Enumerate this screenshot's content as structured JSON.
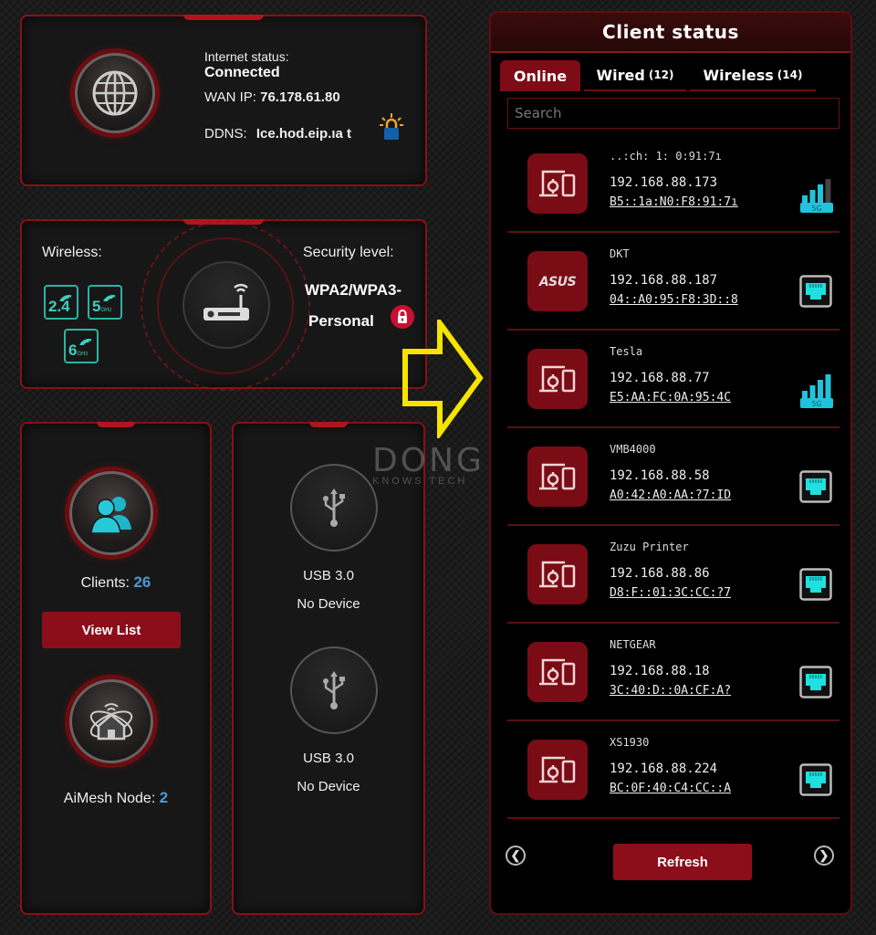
{
  "internet": {
    "status_label": "Internet status:",
    "status_value": "Connected",
    "wan_ip_label": "WAN IP:",
    "wan_ip_value": "76.178.61.80",
    "ddns_label": "DDNS:",
    "ddns_value": "Ice.hod.eip.ıa t"
  },
  "wireless": {
    "label": "Wireless:",
    "bands": [
      {
        "num": "2.4",
        "unit": ""
      },
      {
        "num": "5",
        "unit": "GHz"
      },
      {
        "num": "6",
        "unit": "GHz"
      }
    ],
    "security_label": "Security level:",
    "security_value_line1": "WPA2/WPA3-",
    "security_value_line2": "Personal"
  },
  "clients": {
    "label": "Clients:",
    "count": "26",
    "view_list_label": "View List",
    "aimesh_label": "AiMesh Node:",
    "aimesh_count": "2"
  },
  "usb": [
    {
      "type": "USB 3.0",
      "status": "No Device"
    },
    {
      "type": "USB 3.0",
      "status": "No Device"
    }
  ],
  "watermark": {
    "line1": "DONG",
    "line2": "KNOWS TECH"
  },
  "client_status": {
    "title": "Client status",
    "tabs": [
      {
        "label": "Online",
        "count": "",
        "active": true
      },
      {
        "label": "Wired",
        "count": "(12)",
        "active": false
      },
      {
        "label": "Wireless",
        "count": "(14)",
        "active": false
      }
    ],
    "search_placeholder": "Search",
    "refresh_label": "Refresh",
    "clients": [
      {
        "name": "..:ch: 1: 0:91:7ı",
        "ip": "192.168.88.173",
        "mac": "B5::1a:N0:F8:91:7ı",
        "icon": "generic-device",
        "connection": "wireless-5g",
        "signal_bars": 3
      },
      {
        "name": "DKT",
        "ip": "192.168.88.187",
        "mac": "04::A0:95:F8:3D::8",
        "icon": "asus",
        "connection": "wired",
        "signal_bars": null
      },
      {
        "name": "Tesla",
        "ip": "192.168.88.77",
        "mac": "E5:AA:FC:0A:95:4C",
        "icon": "generic-device",
        "connection": "wireless-5g",
        "signal_bars": 4
      },
      {
        "name": "VMB4000",
        "ip": "192.168.88.58",
        "mac": "A0:42:A0:AA:?7:ID",
        "icon": "generic-device",
        "connection": "wired",
        "signal_bars": null
      },
      {
        "name": "Zuzu Printer",
        "ip": "192.168.88.86",
        "mac": "D8:F::01:3C:CC:?7",
        "icon": "generic-device",
        "connection": "wired",
        "signal_bars": null
      },
      {
        "name": "NETGEAR",
        "ip": "192.168.88.18",
        "mac": "3C:40:D::0A:CF:A?",
        "icon": "generic-device",
        "connection": "wired",
        "signal_bars": null
      },
      {
        "name": "XS1930",
        "ip": "192.168.88.224",
        "mac": "BC:0F:40:C4:CC::A",
        "icon": "generic-device",
        "connection": "wired",
        "signal_bars": null
      }
    ]
  },
  "colors": {
    "accent_red": "#8c0e1b",
    "teal": "#2ec8d6",
    "count_blue": "#4a9ad6",
    "arrow_yellow": "#f5e400"
  }
}
